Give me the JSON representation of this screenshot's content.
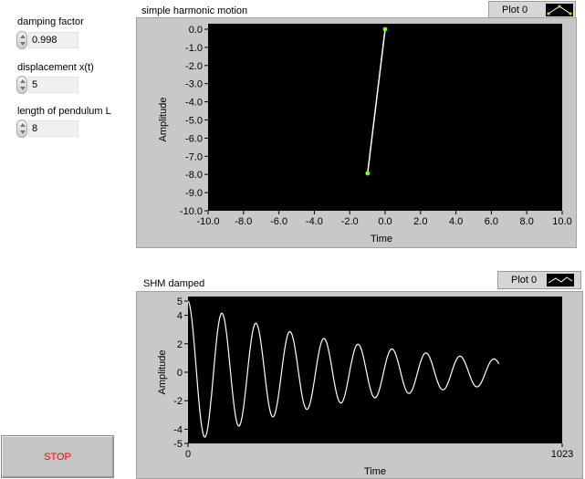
{
  "controls": [
    {
      "label": "damping factor",
      "value": "0.998"
    },
    {
      "label": "displacement x(t)",
      "value": "5"
    },
    {
      "label": "length of pendulum L",
      "value": "8"
    }
  ],
  "stop_label": "STOP",
  "graph1": {
    "title": "simple harmonic motion",
    "legend": "Plot 0",
    "xlabel": "Time",
    "ylabel": "Amplitude",
    "xticks": [
      "-10.0",
      "-8.0",
      "-6.0",
      "-4.0",
      "-2.0",
      "0.0",
      "2.0",
      "4.0",
      "6.0",
      "8.0",
      "10.0"
    ],
    "yticks": [
      "0.0",
      "-1.0",
      "-2.0",
      "-3.0",
      "-4.0",
      "-5.0",
      "-6.0",
      "-7.0",
      "-8.0",
      "-9.0",
      "-10.0"
    ]
  },
  "graph2": {
    "title": "SHM damped",
    "legend": "Plot 0",
    "xlabel": "Time",
    "ylabel": "Amplitude",
    "xticks": [
      "0",
      "1023"
    ],
    "yticks": [
      "5",
      "4",
      "2",
      "0",
      "-2",
      "-4",
      "-5"
    ]
  },
  "chart_data": [
    {
      "type": "line",
      "title": "simple harmonic motion",
      "xlabel": "Time",
      "ylabel": "Amplitude",
      "xlim": [
        -10,
        10
      ],
      "ylim": [
        -10,
        0
      ],
      "x": [
        0.0,
        -0.99
      ],
      "y": [
        0.0,
        -7.94
      ],
      "line_color": "#ffffff",
      "marker_color": "#7fff00"
    },
    {
      "type": "line",
      "title": "SHM damped",
      "xlabel": "Time",
      "ylabel": "Amplitude",
      "xlim": [
        0,
        1023
      ],
      "ylim": [
        -5,
        5
      ],
      "initial_amplitude": 5,
      "damping_per_sample": 0.998,
      "period_samples": 93,
      "sample_count": 1023,
      "line_color": "#ffffff"
    }
  ]
}
